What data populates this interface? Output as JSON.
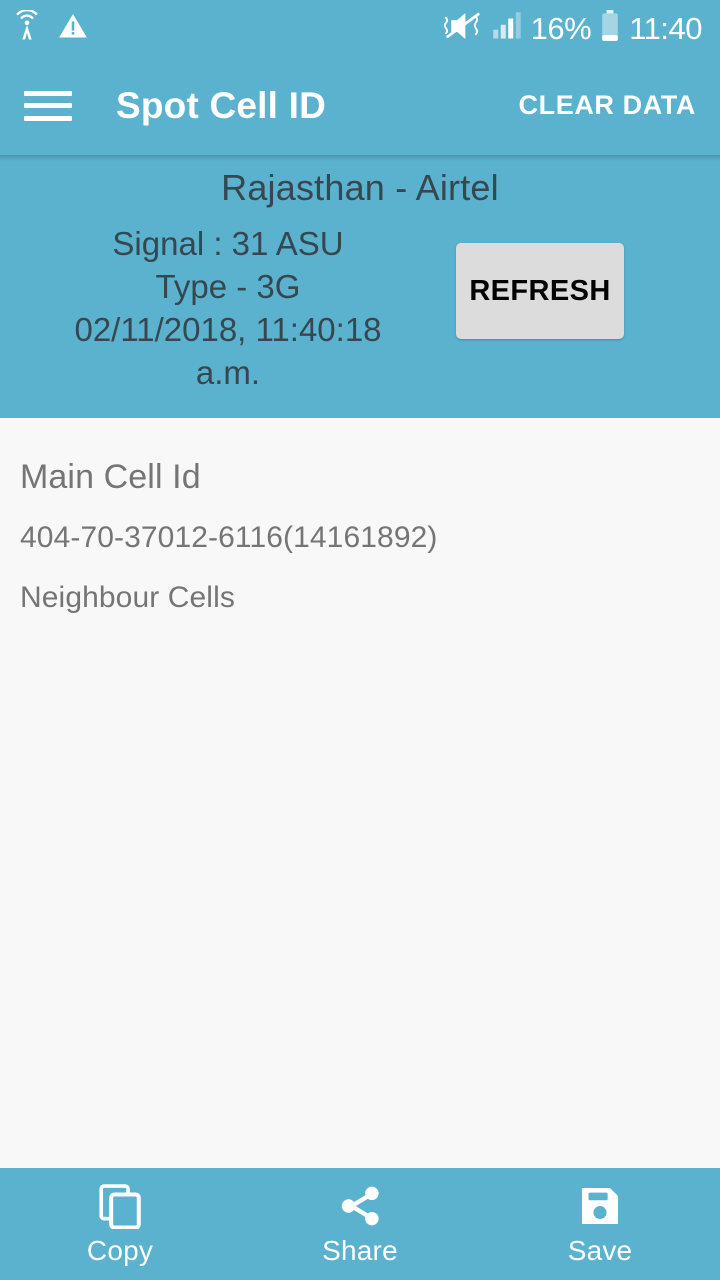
{
  "theme": {
    "primary": "#5bb2cf",
    "content_bg": "#f8f8f8",
    "info_text": "#37474f",
    "content_text": "#757575",
    "button_bg": "#dcdcdc",
    "on_primary": "#ffffff"
  },
  "statusbar": {
    "icons_left": [
      "cell-broadcast-icon",
      "warning-triangle-icon"
    ],
    "icons_right": [
      "mute-vibrate-icon",
      "signal-bars-icon",
      "battery-icon"
    ],
    "battery_percent": "16%",
    "time": "11:40"
  },
  "appbar": {
    "menu_icon": "hamburger-menu-icon",
    "title": "Spot Cell ID",
    "action_label": "CLEAR DATA"
  },
  "info": {
    "carrier": "Rajasthan - Airtel",
    "signal": "Signal : 31 ASU",
    "type": "Type - 3G",
    "timestamp_line1": "02/11/2018, 11:40:18",
    "timestamp_line2": "a.m.",
    "refresh_label": "REFRESH"
  },
  "main": {
    "main_cell_title": "Main Cell Id",
    "main_cell_value": "404-70-37012-6116(14161892)",
    "neighbour_title": "Neighbour Cells",
    "neighbour_cells": []
  },
  "bottombar": {
    "items": [
      {
        "label": "Copy",
        "icon": "copy-icon"
      },
      {
        "label": "Share",
        "icon": "share-icon"
      },
      {
        "label": "Save",
        "icon": "save-floppy-icon"
      }
    ]
  }
}
